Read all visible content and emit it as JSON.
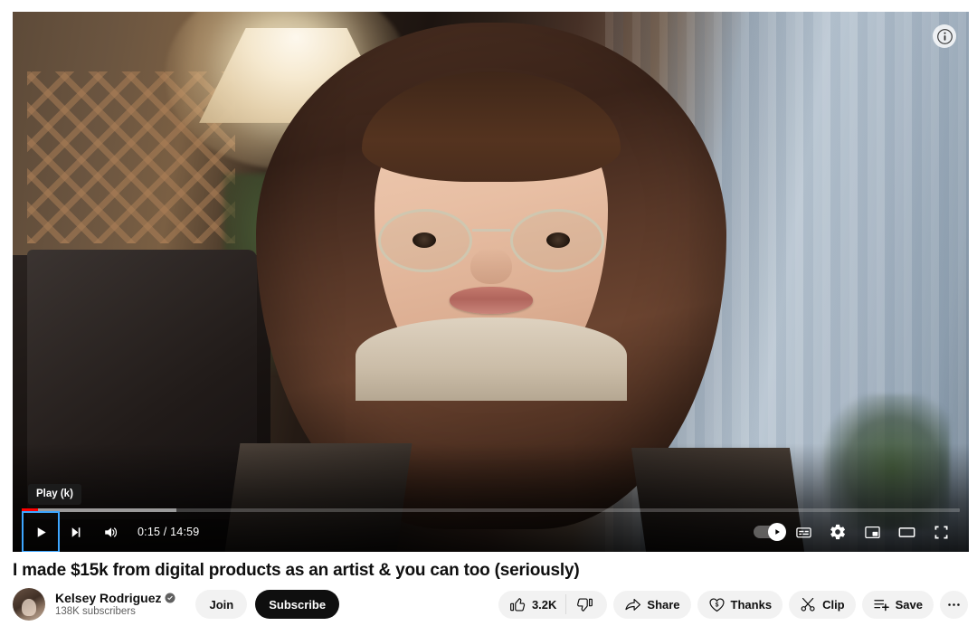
{
  "player": {
    "tooltip": "Play (k)",
    "time_current": "0:15",
    "time_total": "14:59",
    "time_display": "0:15 / 14:59",
    "progress_played_percent": 1.7,
    "progress_loaded_percent": 16.5,
    "accent_color": "#ff0000",
    "focus_color": "#3ea6ff",
    "controls_left": [
      {
        "name": "play-button",
        "icon": "play-icon",
        "label": "Play",
        "focused": true
      },
      {
        "name": "next-button",
        "icon": "next-track-icon",
        "label": "Next"
      },
      {
        "name": "volume-button",
        "icon": "volume-icon",
        "label": "Mute"
      }
    ],
    "controls_right": [
      {
        "name": "autoplay-toggle",
        "icon": "autoplay-icon",
        "label": "Autoplay is on",
        "state": "on"
      },
      {
        "name": "subtitles-button",
        "icon": "subtitles-icon",
        "label": "Subtitles/closed captions"
      },
      {
        "name": "settings-button",
        "icon": "gear-icon",
        "label": "Settings"
      },
      {
        "name": "miniplayer-button",
        "icon": "miniplayer-icon",
        "label": "Miniplayer"
      },
      {
        "name": "theater-button",
        "icon": "theater-mode-icon",
        "label": "Theater mode"
      },
      {
        "name": "fullscreen-button",
        "icon": "fullscreen-icon",
        "label": "Full screen"
      }
    ],
    "info_button": {
      "name": "info-icon",
      "label": "Info"
    }
  },
  "video": {
    "title": "I made $15k from digital products as an artist & you can too (seriously)"
  },
  "channel": {
    "name": "Kelsey Rodriguez",
    "verified": true,
    "subscribers": "138K subscribers",
    "avatar_alt": "Kelsey Rodriguez channel avatar",
    "join_label": "Join",
    "subscribe_label": "Subscribe"
  },
  "actions": {
    "like": {
      "label": "3.2K",
      "icon": "thumbs-up-icon"
    },
    "dislike": {
      "label": "",
      "icon": "thumbs-down-icon"
    },
    "share": {
      "label": "Share",
      "icon": "share-arrow-icon"
    },
    "thanks": {
      "label": "Thanks",
      "icon": "heart-dollar-icon"
    },
    "clip": {
      "label": "Clip",
      "icon": "scissors-icon"
    },
    "save": {
      "label": "Save",
      "icon": "save-playlist-icon"
    },
    "more": {
      "label": "",
      "icon": "more-horizontal-icon"
    }
  },
  "colors": {
    "page_bg": "#ffffff",
    "text_primary": "#0f0f0f",
    "text_secondary": "#606060",
    "pill_bg": "#f2f2f2",
    "subscribe_bg": "#0f0f0f"
  }
}
